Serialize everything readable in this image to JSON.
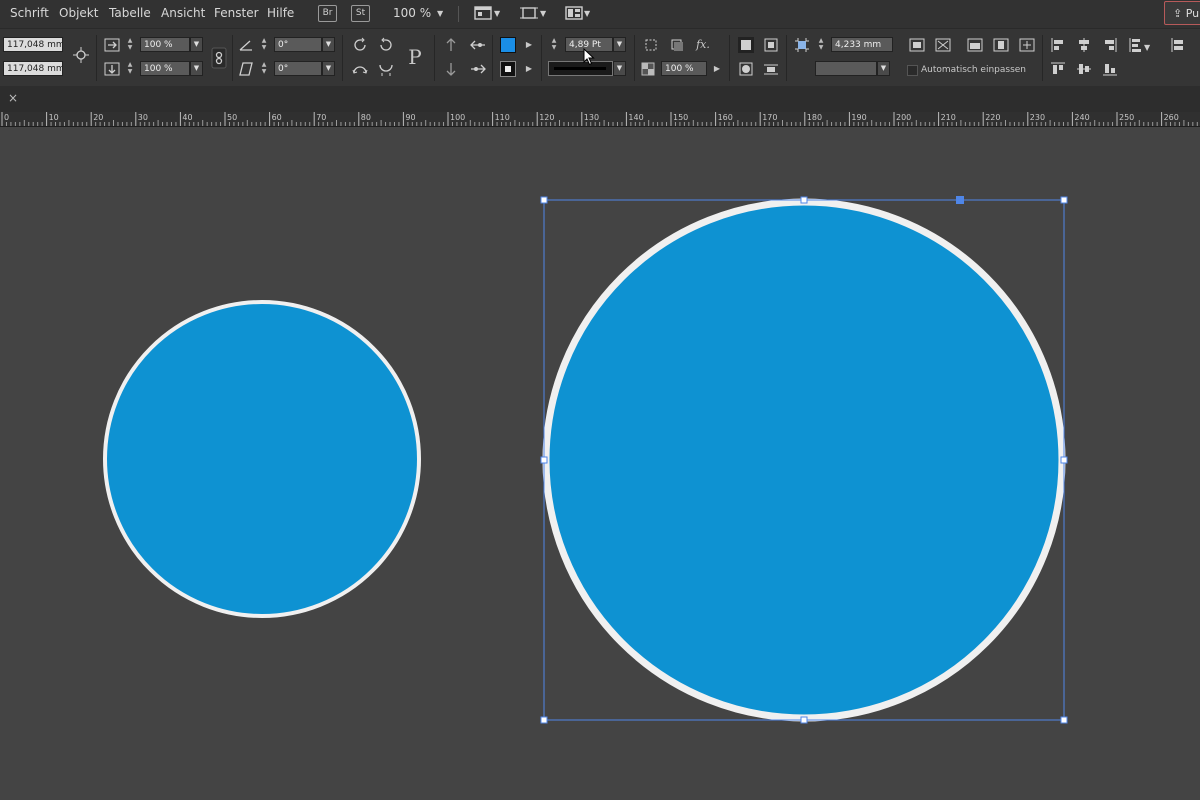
{
  "menu": {
    "items": [
      "Schrift",
      "Objekt",
      "Tabelle",
      "Ansicht",
      "Fenster",
      "Hilfe"
    ],
    "bridge_badge": "Br",
    "stock_badge": "St",
    "zoom": "100 %",
    "publish_label": "Pu"
  },
  "controls": {
    "width": "117,048 mm",
    "height": "117,048 mm",
    "scale_x": "100 %",
    "scale_y": "100 %",
    "rotation": "0°",
    "shear": "0°",
    "stroke_weight": "4,89 Pt",
    "opacity": "100 %",
    "offset": "4,233 mm",
    "auto_fit_label": "Automatisch einpassen",
    "fill_color": "#1a8ee6",
    "stroke_color": "#000000",
    "p_glyph": "P",
    "fx_glyph": "fx."
  },
  "ruler": {
    "ticks": [
      "0",
      "10",
      "20",
      "30",
      "40",
      "50",
      "60",
      "70",
      "80",
      "90",
      "100",
      "110",
      "120",
      "130",
      "140",
      "150",
      "160",
      "170",
      "180",
      "190",
      "200",
      "210",
      "220",
      "230",
      "240",
      "250",
      "260"
    ]
  },
  "canvas": {
    "fill_color": "#0e92d2",
    "stroke_color": "#f0f0f0",
    "selection_color": "#4f86e8"
  },
  "tab": {
    "close_glyph": "×"
  }
}
